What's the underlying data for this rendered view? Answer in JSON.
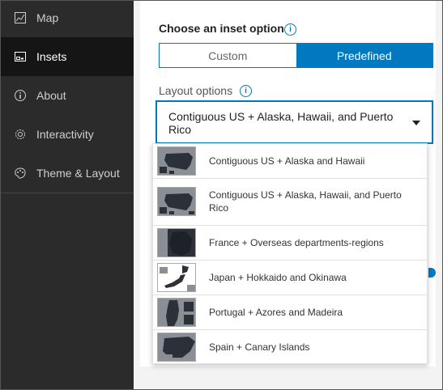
{
  "sidebar": {
    "items": [
      {
        "label": "Map",
        "icon": "map-icon",
        "active": false
      },
      {
        "label": "Insets",
        "icon": "insets-icon",
        "active": true
      },
      {
        "label": "About",
        "icon": "info-icon",
        "active": false
      },
      {
        "label": "Interactivity",
        "icon": "gear-icon",
        "active": false
      },
      {
        "label": "Theme & Layout",
        "icon": "palette-icon",
        "active": false
      }
    ]
  },
  "inset": {
    "title": "Choose an inset option",
    "tabs": {
      "custom": "Custom",
      "predefined": "Predefined"
    },
    "selected_tab": "Predefined",
    "layout_label": "Layout options",
    "selected_layout": "Contiguous US + Alaska, Hawaii, and Puerto Rico",
    "options": [
      {
        "label": "Contiguous US + Alaska and Hawaii",
        "thumb": "us-map"
      },
      {
        "label": "Contiguous US + Alaska, Hawaii, and Puerto Rico",
        "thumb": "us-map"
      },
      {
        "label": "France + Overseas departments-regions",
        "thumb": "france-map"
      },
      {
        "label": "Japan + Hokkaido and Okinawa",
        "thumb": "japan-map"
      },
      {
        "label": "Portugal + Azores and Madeira",
        "thumb": "portugal-map"
      },
      {
        "label": "Spain + Canary Islands",
        "thumb": "spain-map"
      }
    ]
  },
  "colors": {
    "accent": "#0079c1",
    "sidebar_bg": "#2b2b2b",
    "sidebar_active": "#151515"
  }
}
